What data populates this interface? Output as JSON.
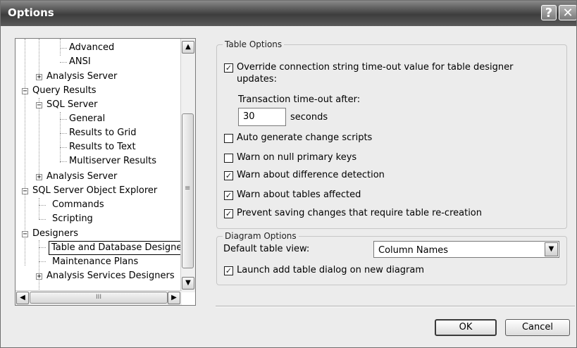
{
  "window": {
    "title": "Options",
    "help_label": "?",
    "close_label": "✕"
  },
  "tree": {
    "items": [
      {
        "label": "Advanced"
      },
      {
        "label": "ANSI"
      },
      {
        "label": "Analysis Server"
      },
      {
        "label": "Query Results"
      },
      {
        "label": "SQL Server"
      },
      {
        "label": "General"
      },
      {
        "label": "Results to Grid"
      },
      {
        "label": "Results to Text"
      },
      {
        "label": "Multiserver Results"
      },
      {
        "label": "Analysis Server"
      },
      {
        "label": "SQL Server Object Explorer"
      },
      {
        "label": "Commands"
      },
      {
        "label": "Scripting"
      },
      {
        "label": "Designers"
      },
      {
        "label": "Table and Database Designers"
      },
      {
        "label": "Maintenance Plans"
      },
      {
        "label": "Analysis Services Designers"
      }
    ],
    "expand_plus": "+",
    "expand_minus": "−",
    "scroll_up": "▲",
    "scroll_down": "▼",
    "scroll_left": "◀",
    "scroll_right": "▶",
    "hthumb_grip": "III",
    "vthumb_grip": "≡"
  },
  "table_options": {
    "group_label": "Table Options",
    "override_timeout": {
      "label": "Override connection string time-out value for table designer",
      "label2": "updates:",
      "checked": true
    },
    "transaction_label": "Transaction time-out after:",
    "timeout_value": "30",
    "seconds_label": "seconds",
    "auto_generate": {
      "label": "Auto generate change scripts",
      "checked": false
    },
    "warn_null": {
      "label": "Warn on null primary keys",
      "checked": false
    },
    "warn_difference": {
      "label": "Warn about difference detection",
      "checked": true
    },
    "warn_tables": {
      "label": "Warn about tables affected",
      "checked": true
    },
    "prevent_saving": {
      "label": "Prevent saving changes that require table re-creation",
      "checked": true
    }
  },
  "diagram_options": {
    "group_label": "Diagram Options",
    "default_view_label": "Default table view:",
    "default_view_value": "Column Names",
    "launch_add_table": {
      "label": "Launch add table dialog on new diagram",
      "checked": true
    }
  },
  "check_mark": "✓",
  "buttons": {
    "ok": "OK",
    "cancel": "Cancel"
  }
}
